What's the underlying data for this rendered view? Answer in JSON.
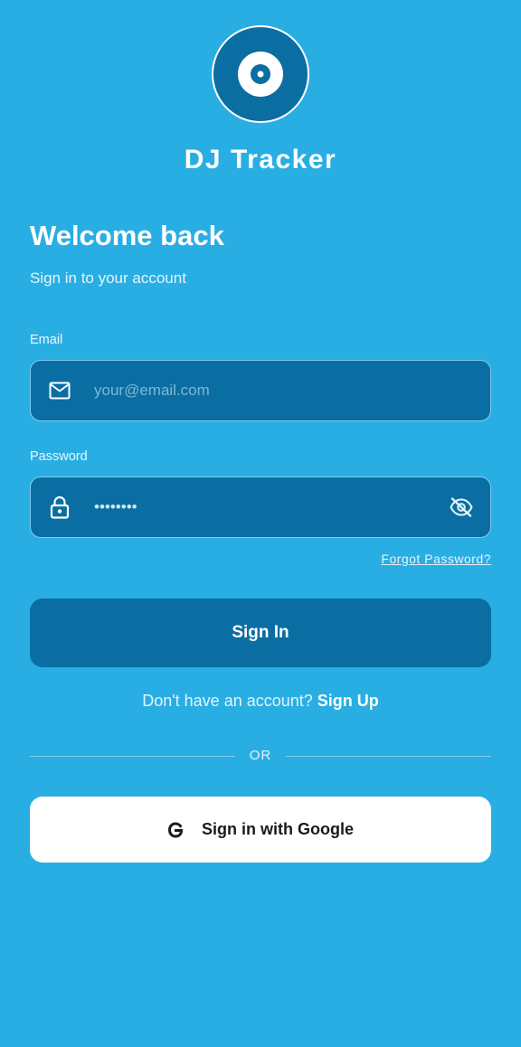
{
  "app": {
    "title": "DJ Tracker",
    "logo_icon": "vinyl-record-icon"
  },
  "header": {
    "welcome": "Welcome back",
    "subtitle": "Sign in to your account"
  },
  "form": {
    "email": {
      "label": "Email",
      "placeholder": "your@email.com",
      "value": "",
      "icon": "mail-icon"
    },
    "password": {
      "label": "Password",
      "value": "••••••••",
      "icon": "lock-icon",
      "toggle_icon": "eye-off-icon"
    },
    "forgot_label": "Forgot Password?",
    "submit_label": "Sign In"
  },
  "signup": {
    "prompt": "Don't have an account?",
    "link": "Sign Up"
  },
  "divider_text": "OR",
  "google": {
    "label": "Sign in with Google",
    "icon": "google-g-icon"
  },
  "colors": {
    "background": "#29aee4",
    "primary": "#0a6ea2",
    "field_border": "#7fcdee",
    "text": "#ffffff"
  }
}
